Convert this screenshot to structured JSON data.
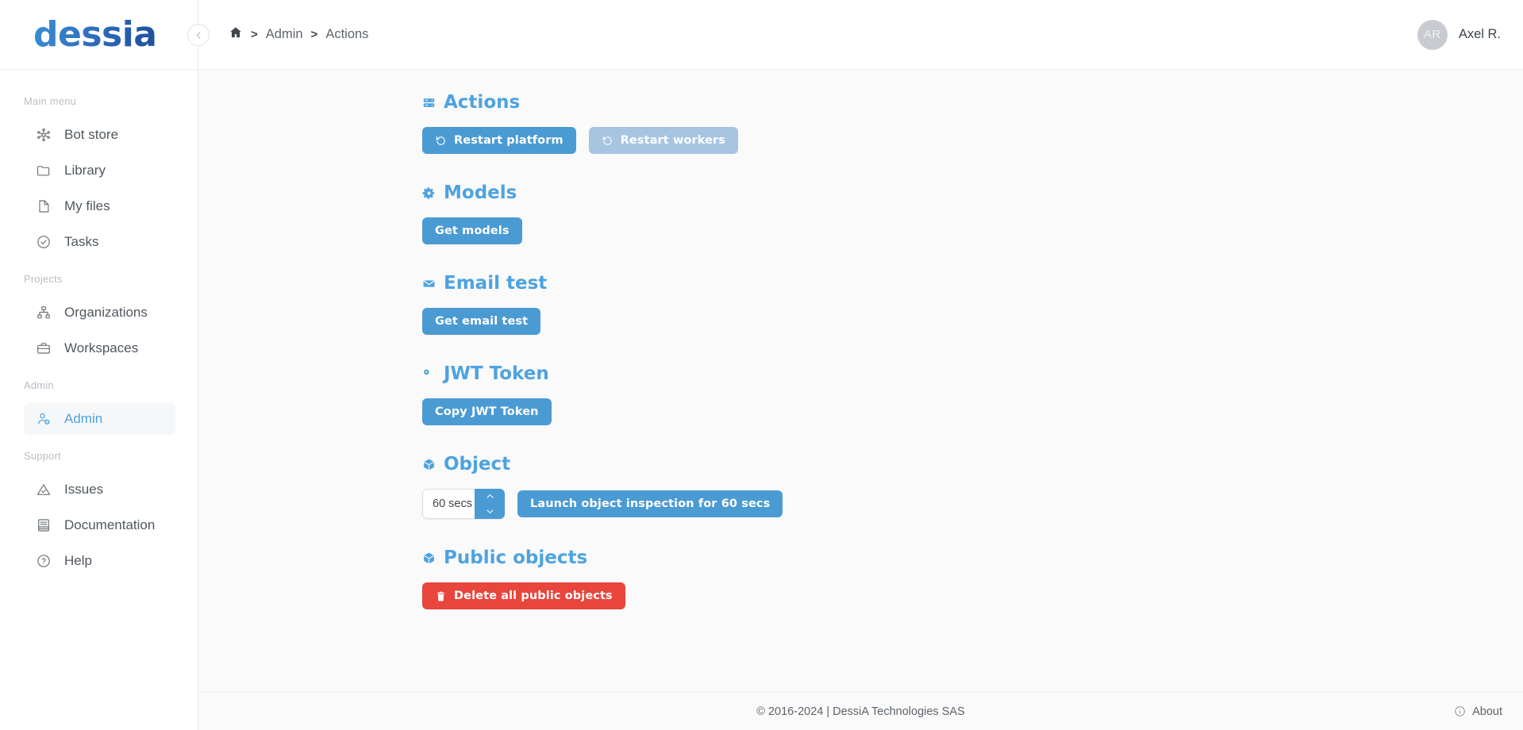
{
  "brand": {
    "name": "dessia"
  },
  "sidebar": {
    "sections": [
      {
        "label": "Main menu",
        "items": [
          {
            "label": "Bot store",
            "icon": "bot-store-icon"
          },
          {
            "label": "Library",
            "icon": "folder-icon"
          },
          {
            "label": "My files",
            "icon": "file-icon"
          },
          {
            "label": "Tasks",
            "icon": "check-circle-icon"
          }
        ]
      },
      {
        "label": "Projects",
        "items": [
          {
            "label": "Organizations",
            "icon": "org-chart-icon"
          },
          {
            "label": "Workspaces",
            "icon": "briefcase-icon"
          }
        ]
      },
      {
        "label": "Admin",
        "items": [
          {
            "label": "Admin",
            "icon": "user-gear-icon",
            "active": true
          }
        ]
      },
      {
        "label": "Support",
        "items": [
          {
            "label": "Issues",
            "icon": "alert-triangle-icon"
          },
          {
            "label": "Documentation",
            "icon": "book-icon"
          },
          {
            "label": "Help",
            "icon": "question-circle-icon"
          }
        ]
      }
    ]
  },
  "topbar": {
    "breadcrumb": {
      "home": "home-icon",
      "separator": ">",
      "items": [
        "Admin",
        "Actions"
      ]
    },
    "user": {
      "initials": "AR",
      "name": "Axel R."
    }
  },
  "content": {
    "sections": [
      {
        "id": "actions",
        "title": "Actions",
        "icon": "server-icon",
        "buttons": [
          {
            "label": "Restart platform",
            "icon": "rotate-ccw-icon",
            "style": "primary"
          },
          {
            "label": "Restart workers",
            "icon": "rotate-ccw-icon",
            "style": "disabled"
          }
        ]
      },
      {
        "id": "models",
        "title": "Models",
        "icon": "gear-icon",
        "buttons": [
          {
            "label": "Get models",
            "style": "primary"
          }
        ]
      },
      {
        "id": "email-test",
        "title": "Email test",
        "icon": "envelope-icon",
        "buttons": [
          {
            "label": "Get email test",
            "style": "primary"
          }
        ]
      },
      {
        "id": "jwt-token",
        "title": "JWT Token",
        "icon": "key-icon",
        "buttons": [
          {
            "label": "Copy JWT Token",
            "style": "primary"
          }
        ]
      },
      {
        "id": "object",
        "title": "Object",
        "icon": "cube-icon",
        "duration_input": {
          "value": "60 secs",
          "placeholder": "60 secs"
        },
        "buttons": [
          {
            "label": "Launch object inspection for 60 secs",
            "style": "primary"
          }
        ]
      },
      {
        "id": "public-objects",
        "title": "Public objects",
        "icon": "cube-icon",
        "buttons": [
          {
            "label": "Delete all public objects",
            "icon": "trash-icon",
            "style": "danger"
          }
        ]
      }
    ]
  },
  "footer": {
    "copyright": "© 2016-2024 | DessiA Technologies SAS",
    "about": "About"
  },
  "colors": {
    "accent": "#4a9bd4",
    "accent_title": "#4da3e0",
    "disabled": "#a7c4e1",
    "danger": "#e8453c",
    "content_bg": "#fafafa"
  }
}
